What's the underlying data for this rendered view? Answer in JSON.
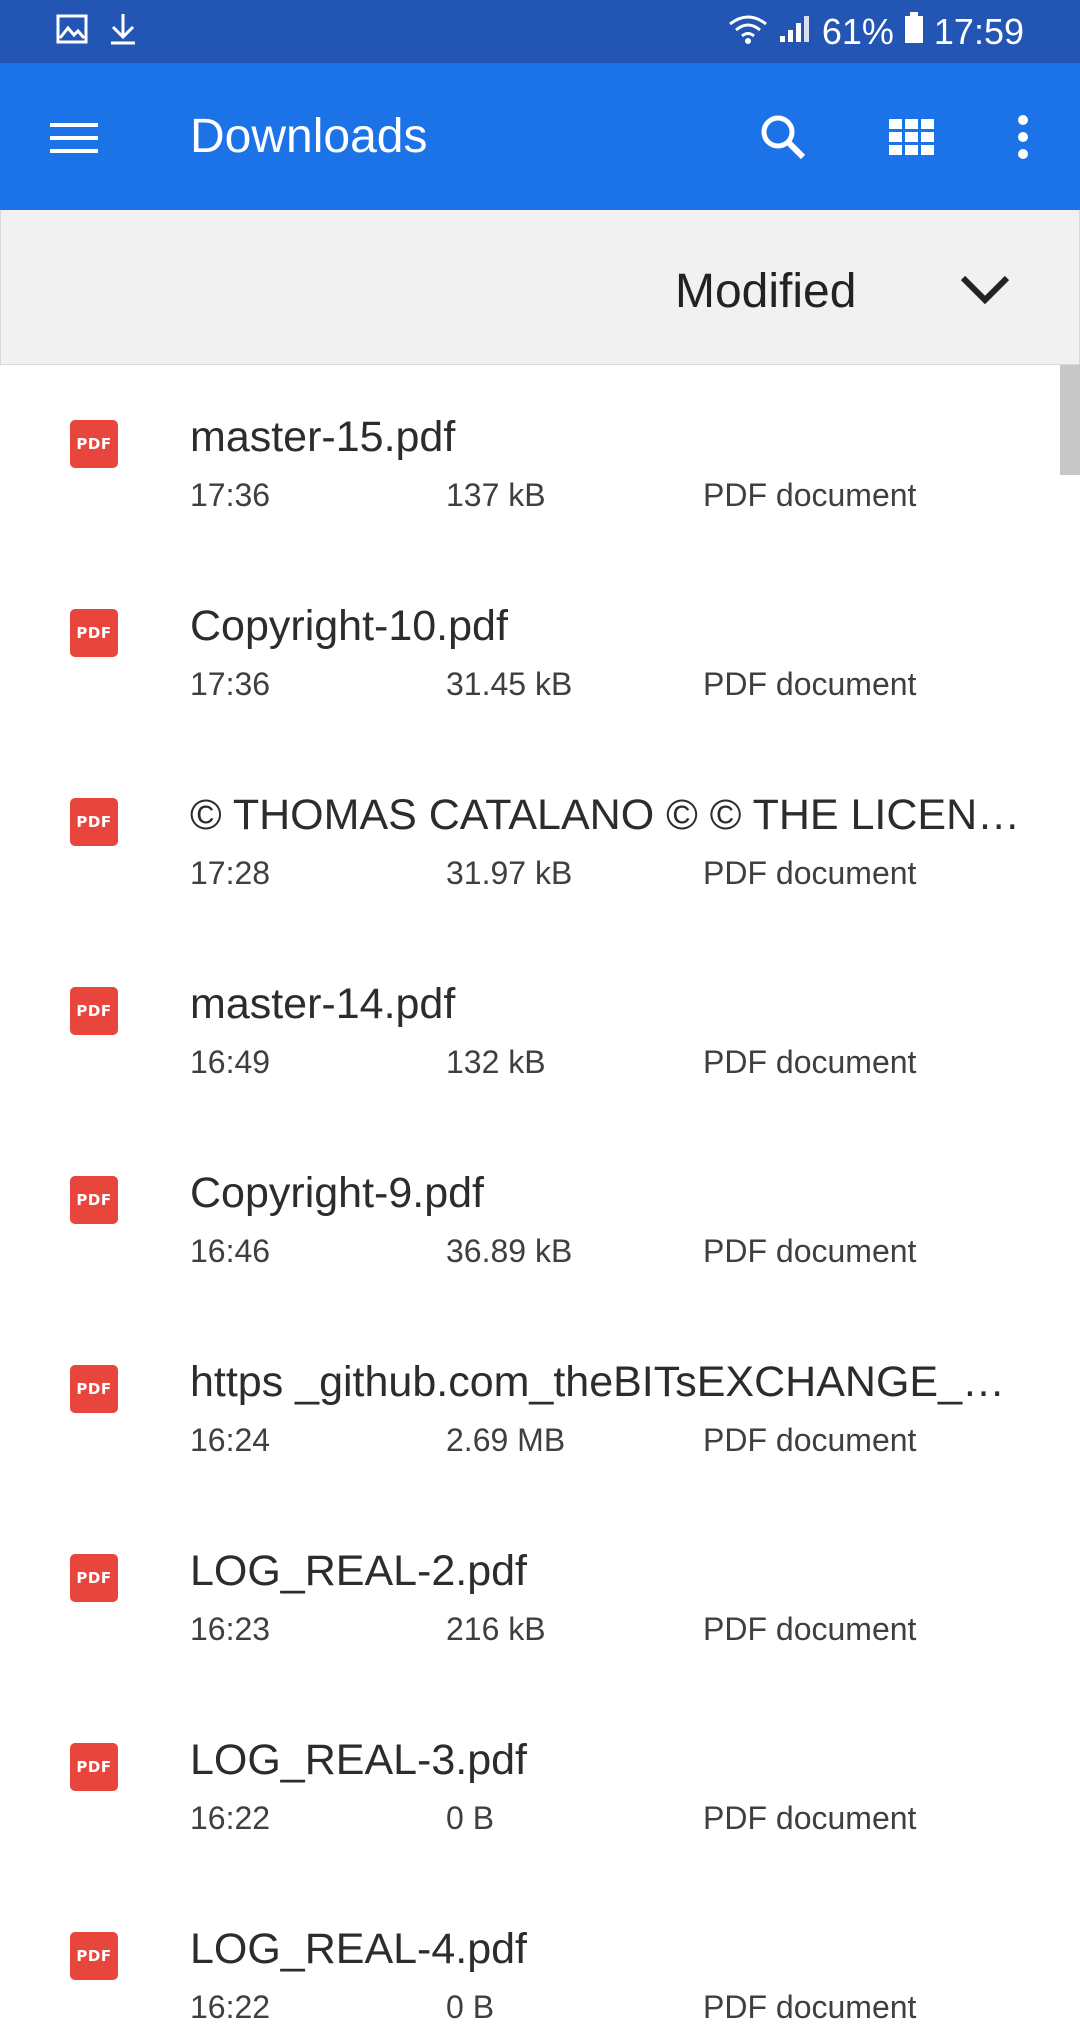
{
  "status_bar": {
    "battery": "61%",
    "time": "17:59",
    "icons": [
      "image-icon",
      "download-icon",
      "wifi-icon",
      "signal-icon",
      "battery-icon"
    ]
  },
  "app_bar": {
    "title": "Downloads",
    "icons": [
      "menu-icon",
      "search-icon",
      "grid-view-icon",
      "more-vert-icon"
    ],
    "accent_color": "#1c73e8"
  },
  "sort": {
    "label": "Modified"
  },
  "files": [
    {
      "name": "master-15.pdf",
      "time": "17:36",
      "size": "137 kB",
      "type": "PDF document",
      "icon_label": "PDF"
    },
    {
      "name": "Copyright-10.pdf",
      "time": "17:36",
      "size": "31.45 kB",
      "type": "PDF document",
      "icon_label": "PDF"
    },
    {
      "name": "© THOMAS CATALANO © © THE LICEN…",
      "time": "17:28",
      "size": "31.97 kB",
      "type": "PDF document",
      "icon_label": "PDF"
    },
    {
      "name": "master-14.pdf",
      "time": "16:49",
      "size": "132 kB",
      "type": "PDF document",
      "icon_label": "PDF"
    },
    {
      "name": "Copyright-9.pdf",
      "time": "16:46",
      "size": "36.89 kB",
      "type": "PDF document",
      "icon_label": "PDF"
    },
    {
      "name": "https _github.com_theBITsEXCHANGE_…",
      "time": "16:24",
      "size": "2.69 MB",
      "type": "PDF document",
      "icon_label": "PDF"
    },
    {
      "name": "LOG_REAL-2.pdf",
      "time": "16:23",
      "size": "216 kB",
      "type": "PDF document",
      "icon_label": "PDF"
    },
    {
      "name": "LOG_REAL-3.pdf",
      "time": "16:22",
      "size": "0 B",
      "type": "PDF document",
      "icon_label": "PDF"
    },
    {
      "name": "LOG_REAL-4.pdf",
      "time": "16:22",
      "size": "0 B",
      "type": "PDF document",
      "icon_label": "PDF"
    }
  ]
}
